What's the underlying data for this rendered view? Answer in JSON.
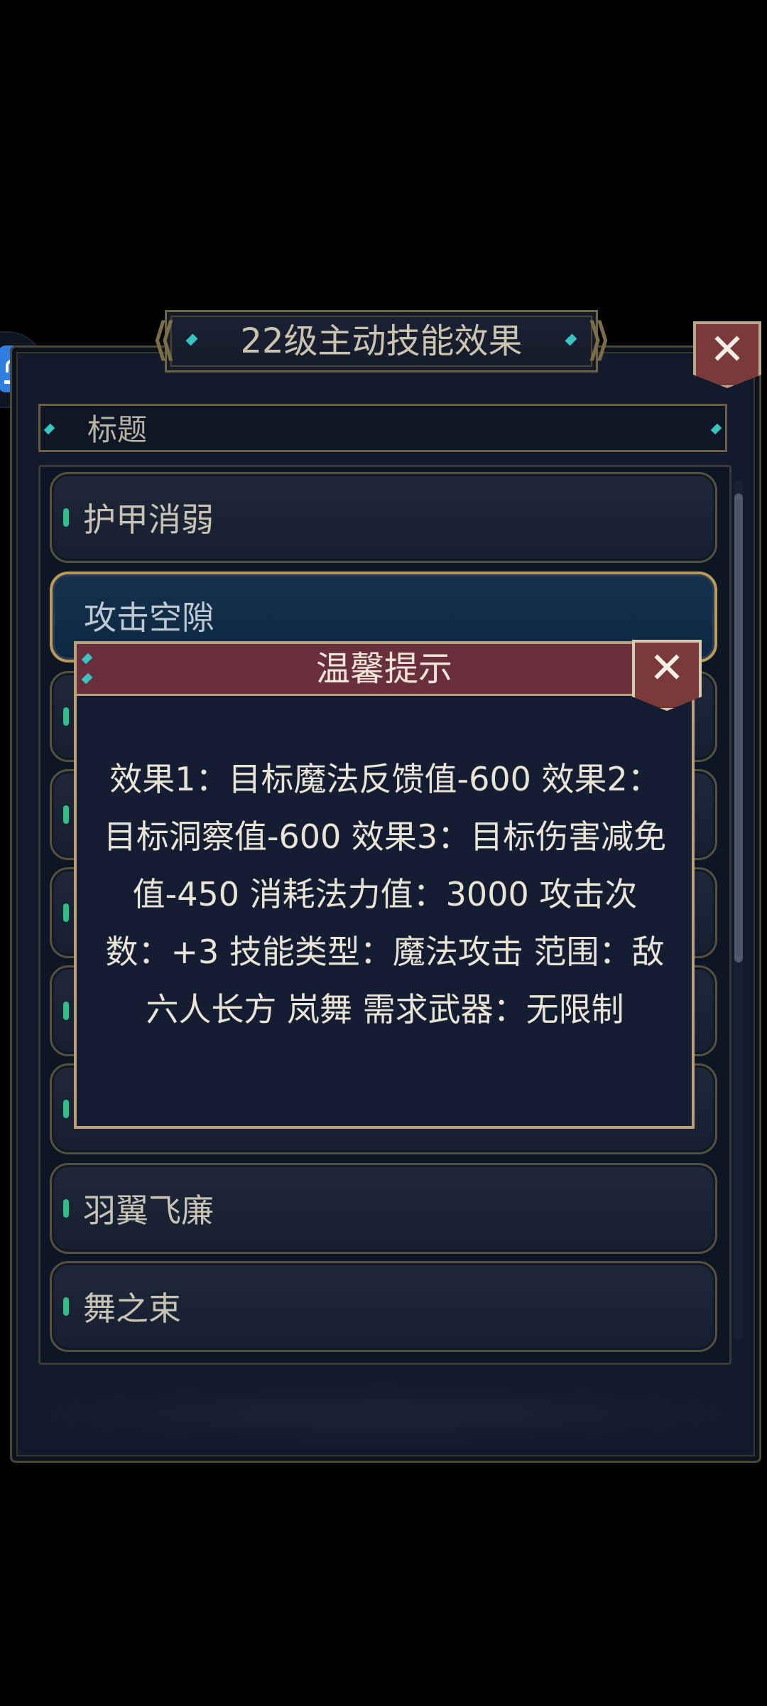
{
  "panel": {
    "title": "22级主动技能效果",
    "header_label": "标题"
  },
  "skills": [
    {
      "label": "护甲消弱"
    },
    {
      "label": "攻击空隙"
    },
    {
      "label": "羽翼飞廉"
    },
    {
      "label": "舞之束"
    }
  ],
  "dialog": {
    "title": "温馨提示",
    "body": "效果1：目标魔法反馈值-600 效果2：目标洞察值-600 效果3：目标伤害减免值-450 消耗法力值：3000 攻击次数：+3 技能类型：魔法攻击 范围：敌六人长方 岚舞 需求武器：无限制"
  },
  "icons": {
    "close": "close-icon",
    "float": "assistant-icon"
  },
  "colors": {
    "panel_bg": "#121a2b",
    "gold_border": "#b7a17a",
    "dialog_title_bg": "#6a2f3d",
    "close_bg": "#7a3a3a",
    "pip": "#2fbf88"
  }
}
